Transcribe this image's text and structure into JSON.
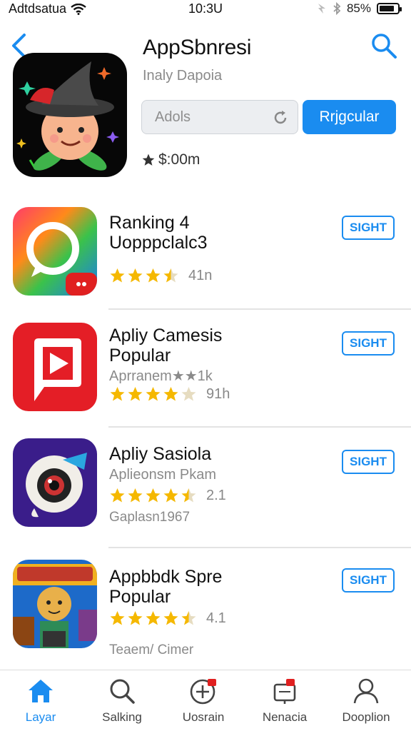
{
  "status_bar": {
    "carrier": "Adtdsatua",
    "time": "10:3U",
    "battery": "85%",
    "battery_level": 0.85
  },
  "header": {
    "title": "AppSbnresi",
    "subtitle": "Inaly Dapoia",
    "input_placeholder": "Adols",
    "button_label": "Rrjgcular",
    "rating_text": "$:00m",
    "icons": [
      "back-chevron-icon",
      "search-icon",
      "refresh-icon",
      "star-icon"
    ]
  },
  "apps": [
    {
      "title_lines": [
        "Ranking 4",
        "Uopppclalc3"
      ],
      "subtitle": "",
      "rating_value": "41n",
      "stars": 3.5,
      "extra": "",
      "button_label": "SIGHT",
      "icon": "chat-bubble-app-icon"
    },
    {
      "title_lines": [
        "Apliy Camesis",
        "Popular"
      ],
      "subtitle": "Aprranem★★1k",
      "rating_value": "91h",
      "stars": 4,
      "extra": "",
      "button_label": "SIGHT",
      "icon": "video-play-app-icon"
    },
    {
      "title_lines": [
        "Apliy Sasiola"
      ],
      "subtitle": "Aplieonsm Pkam",
      "rating_value": "2.1",
      "stars": 4.5,
      "extra": "Gaplasn1967",
      "button_label": "SIGHT",
      "icon": "camera-bot-app-icon"
    },
    {
      "title_lines": [
        "Appbbdk Spre",
        "Popular"
      ],
      "subtitle": "",
      "rating_value": "4.1",
      "stars": 4.5,
      "extra": "Teaem/ Cimer",
      "button_label": "SIGHT",
      "icon": "game-character-app-icon"
    }
  ],
  "tab_bar": [
    {
      "label": "Layar",
      "icon": "home-icon",
      "active": true
    },
    {
      "label": "Salking",
      "icon": "search-icon",
      "active": false
    },
    {
      "label": "Uosrain",
      "icon": "plus-circle-icon",
      "active": false
    },
    {
      "label": "Nenacia",
      "icon": "news-icon",
      "active": false
    },
    {
      "label": "Dooplion",
      "icon": "profile-icon",
      "active": false
    }
  ],
  "colors": {
    "accent": "#1a8cf0",
    "star": "#f5b800",
    "divider": "#e3e3e3"
  }
}
